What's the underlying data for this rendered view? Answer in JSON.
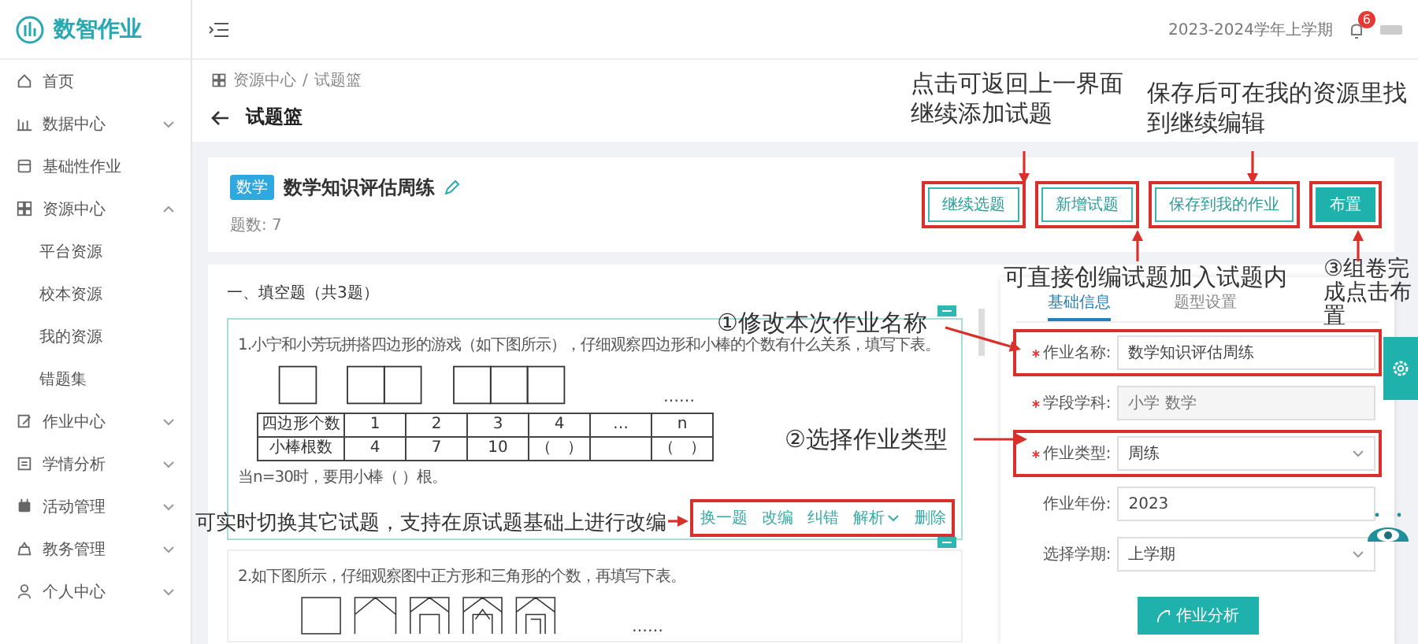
{
  "app": {
    "logo": "数智作业"
  },
  "sidebar": {
    "items": [
      {
        "label": "首页"
      },
      {
        "label": "数据中心",
        "expanded": false
      },
      {
        "label": "基础性作业"
      },
      {
        "label": "资源中心",
        "expanded": true,
        "children": [
          {
            "label": "平台资源"
          },
          {
            "label": "校本资源"
          },
          {
            "label": "我的资源"
          },
          {
            "label": "错题集"
          }
        ]
      },
      {
        "label": "作业中心",
        "expanded": false
      },
      {
        "label": "学情分析",
        "expanded": false
      },
      {
        "label": "活动管理",
        "expanded": false
      },
      {
        "label": "教务管理",
        "expanded": false
      },
      {
        "label": "个人中心",
        "expanded": false
      }
    ]
  },
  "header": {
    "term": "2023-2024学年上学期",
    "notification_count": "6"
  },
  "breadcrumb": {
    "items": [
      "资源中心",
      "试题篮"
    ],
    "separator": "/"
  },
  "page_title": "试题篮",
  "homework": {
    "subject_tag": "数学",
    "title": "数学知识评估周练",
    "question_count": "题数: 7"
  },
  "actions": [
    {
      "label": "继续选题",
      "kind": "outline",
      "highlighted": true
    },
    {
      "label": "新增试题",
      "kind": "outline",
      "highlighted": true
    },
    {
      "label": "保存到我的作业",
      "kind": "outline",
      "highlighted": true
    },
    {
      "label": "布置",
      "kind": "primary",
      "highlighted": true
    }
  ],
  "section": {
    "heading": "一、填空题（共3题）"
  },
  "questions": [
    {
      "text": "1.小宁和小芳玩拼搭四边形的游戏（如下图所示），仔细观察四边形和小棒的个数有什么关系，填写下表。",
      "figure_ellipsis": "……",
      "table": {
        "rows": [
          {
            "label": "四边形个数",
            "values": [
              "1",
              "2",
              "3",
              "4"
            ],
            "gap": "…",
            "last": "n"
          },
          {
            "label": "小棒根数",
            "values": [
              "4",
              "7",
              "10",
              "（　）"
            ],
            "last": "（　）"
          }
        ]
      },
      "answer_prompt": "当n=30时，要用小棒（ ）根。",
      "actions_highlighted": true,
      "actions": [
        {
          "label": "换一题",
          "kind": "link"
        },
        {
          "label": "改编",
          "kind": "link"
        },
        {
          "label": "纠错",
          "kind": "link"
        },
        {
          "label": "解析",
          "kind": "dropdown"
        },
        {
          "label": "删除",
          "kind": "link"
        }
      ]
    },
    {
      "text": "2.如下图所示，仔细观察图中正方形和三角形的个数，再填写下表。",
      "figure_ellipsis": "……"
    }
  ],
  "settings": {
    "tabs": [
      {
        "label": "基础信息",
        "selected": true
      },
      {
        "label": "题型设置",
        "selected": false
      }
    ],
    "fields": [
      {
        "label": "作业名称:",
        "required": true,
        "kind": "text",
        "value": "数学知识评估周练",
        "disabled": false,
        "highlighted": true
      },
      {
        "label": "学段学科:",
        "required": true,
        "kind": "text",
        "placeholder": "小学 数学",
        "disabled": true,
        "highlighted": false
      },
      {
        "label": "作业类型:",
        "required": true,
        "kind": "select",
        "value": "周练",
        "disabled": false,
        "highlighted": true
      },
      {
        "label": "作业年份:",
        "required": false,
        "kind": "text",
        "value": "2023",
        "disabled": false,
        "highlighted": false
      },
      {
        "label": "选择学期:",
        "required": false,
        "kind": "select",
        "value": "上学期",
        "disabled": false,
        "highlighted": false
      }
    ],
    "button": "作业分析"
  },
  "annotations": [
    {
      "lines": [
        "点击可返回上一界面",
        "继续添加试题"
      ]
    },
    {
      "lines": [
        "保存后可在我的资源里找",
        "到继续编辑"
      ]
    },
    {
      "lines": [
        "可直接创编试题加入试题内"
      ]
    },
    {
      "lines": [
        "③组卷完",
        "成点击布",
        "置"
      ]
    },
    {
      "lines": [
        "①修改本次作业名称"
      ]
    },
    {
      "lines": [
        "②选择作业类型"
      ]
    },
    {
      "lines": [
        "可实时切换其它试题，支持在原试题基础上进行改编"
      ]
    }
  ]
}
